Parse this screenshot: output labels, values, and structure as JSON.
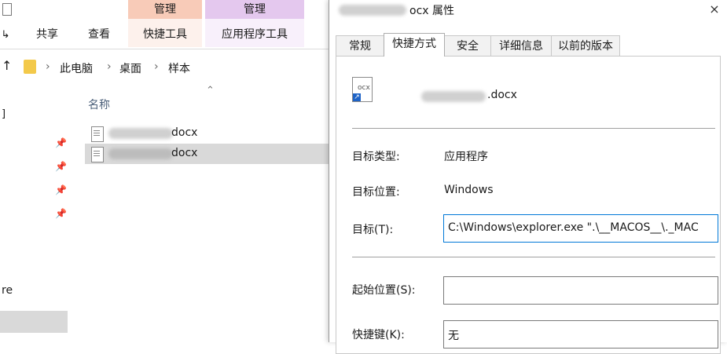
{
  "explorer": {
    "context_tabs": [
      {
        "label": "管理",
        "color": "#f8cbb8"
      },
      {
        "label": "管理",
        "color": "#e4c8ee"
      }
    ],
    "ribbon_tabs": [
      "共享",
      "查看",
      "快捷工具",
      "应用程序工具"
    ],
    "breadcrumb": [
      "此电脑",
      "桌面",
      "样本"
    ],
    "column_header": "名称",
    "files": [
      {
        "suffix": "docx",
        "selected": false
      },
      {
        "suffix": "docx",
        "selected": true
      }
    ],
    "left_edge_text": "re"
  },
  "dialog": {
    "title_suffix": "ocx 属性",
    "close_glyph": "×",
    "tabs": [
      "常规",
      "快捷方式",
      "安全",
      "详细信息",
      "以前的版本"
    ],
    "active_tab": "快捷方式",
    "file_name_suffix": ".docx",
    "target_type_label": "目标类型:",
    "target_type_value": "应用程序",
    "target_location_label": "目标位置:",
    "target_location_value": "Windows",
    "target_label": "目标(T):",
    "target_value": "C:\\Windows\\explorer.exe \".\\__MACOS__\\._MAC",
    "start_in_label": "起始位置(S):",
    "start_in_value": "",
    "shortcut_key_label": "快捷键(K):",
    "shortcut_key_value": "无"
  },
  "colors": {
    "selection": "#d9d9d9",
    "focus_border": "#0078d7"
  }
}
